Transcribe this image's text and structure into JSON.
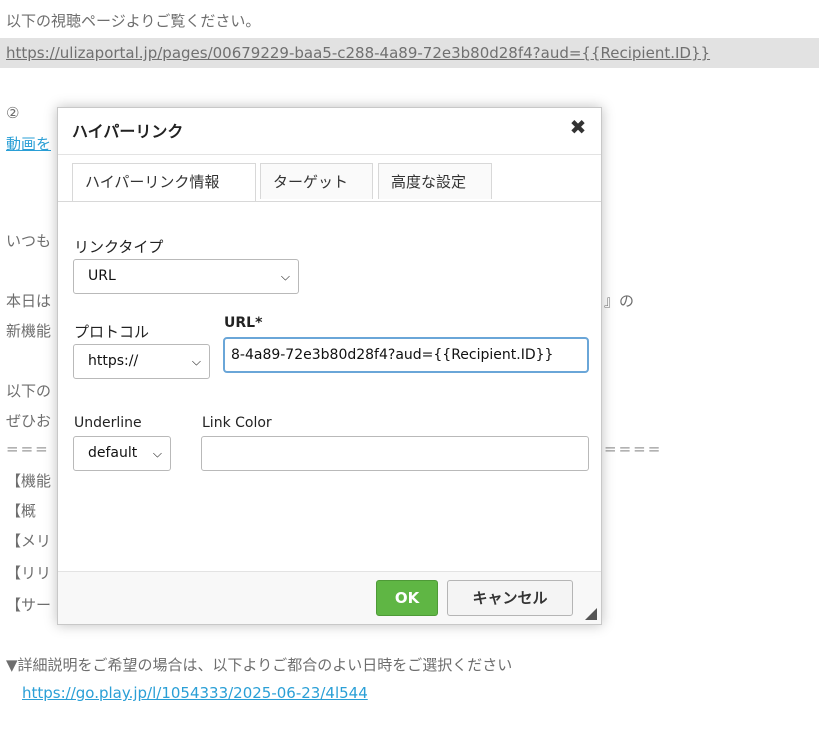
{
  "background": {
    "line1": "以下の視聴ページよりご覧ください。",
    "url_line": "https://ulizaportal.jp/pages/00679229-baa5-c288-4a89-72e3b80d28f4?aud={{Recipient.ID}}",
    "circle2": "②",
    "video_link_fragment": "動画を",
    "itsumo": "いつも",
    "honjitsu": "本日は",
    "shin_kino": "新機能",
    "bracket_tail": "』の",
    "ika": "以下の",
    "zehi": "ぜひお",
    "separator_left": "===",
    "separator_right": "====",
    "kino": "【機能",
    "gai": "【概",
    "meri": "【メリ",
    "riri": "【リリ",
    "sa": "【サー",
    "detail_line": "▼詳細説明をご希望の場合は、以下よりご都合のよい日時をご選択ください",
    "detail_link": "https://go.play.jp/l/1054333/2025-06-23/4l544"
  },
  "dialog": {
    "title": "ハイパーリンク",
    "close_symbol": "✖",
    "tabs": [
      {
        "label": "ハイパーリンク情報"
      },
      {
        "label": "ターゲット"
      },
      {
        "label": "高度な設定"
      }
    ],
    "link_type_label": "リンクタイプ",
    "link_type_value": "URL",
    "protocol_label": "プロトコル",
    "protocol_value": "https://",
    "url_label": "URL*",
    "url_value": "8-4a89-72e3b80d28f4?aud={{Recipient.ID}}",
    "underline_label": "Underline",
    "underline_value": "default",
    "link_color_label": "Link Color",
    "link_color_value": "",
    "ok_label": "OK",
    "cancel_label": "キャンセル"
  },
  "colors": {
    "ok_green": "#5fb644",
    "link_blue": "#2a9fd6",
    "focus_border": "#6aa6d8"
  }
}
